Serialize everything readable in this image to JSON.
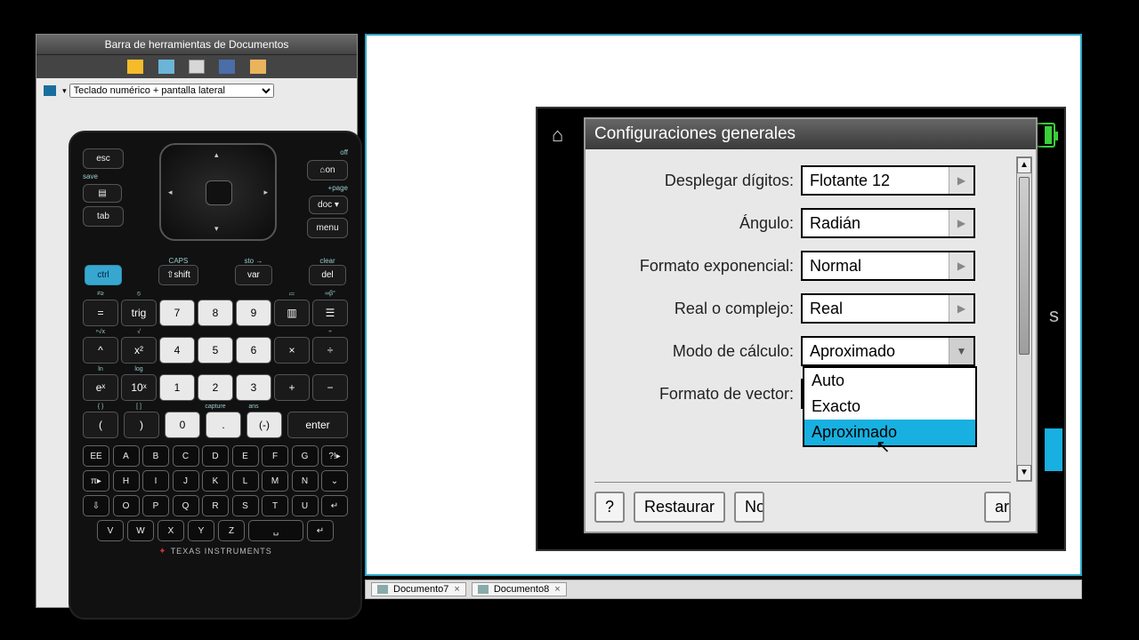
{
  "toolbar": {
    "title": "Barra de herramientas de Documentos"
  },
  "view_selector": {
    "value": "Teclado numérico + pantalla lateral"
  },
  "calc": {
    "esc": "esc",
    "on": "⌂on",
    "off": "off",
    "save": "save",
    "page": "+page",
    "doc": "doc ▾",
    "tab": "tab",
    "menu": "menu",
    "caps": "CAPS",
    "shift": "⇧shift",
    "sto": "sto →",
    "var": "var",
    "clear": "clear",
    "del": "del",
    "ctrl": "ctrl",
    "eq": "=",
    "trig": "trig",
    "enter": "enter",
    "capture": "capture",
    "ans": "ans",
    "brand": "TEXAS INSTRUMENTS",
    "nums": {
      "7": "7",
      "8": "8",
      "9": "9",
      "4": "4",
      "5": "5",
      "6": "6",
      "1": "1",
      "2": "2",
      "3": "3",
      "0": "0",
      "dot": ".",
      "neg": "(-)"
    },
    "ops": {
      "mul": "×",
      "div": "÷",
      "plus": "+",
      "minus": "−"
    },
    "fx": {
      "caret": "^",
      "x2": "x²",
      "ex": "eˣ",
      "tenx": "10ˣ",
      "lp": "(",
      "rp": ")"
    },
    "alpha": [
      "EE",
      "A",
      "B",
      "C",
      "D",
      "E",
      "F",
      "G",
      "?!▸",
      "π▸",
      "H",
      "I",
      "J",
      "K",
      "L",
      "M",
      "N",
      "⌄",
      "⇩",
      "O",
      "P",
      "Q",
      "R",
      "S",
      "T",
      "U",
      "↵",
      "V",
      "W",
      "X",
      "Y",
      "Z",
      "␣",
      "↵"
    ]
  },
  "dialog": {
    "title": "Configuraciones generales",
    "rows": [
      {
        "label": "Desplegar dígitos:",
        "value": "Flotante 12"
      },
      {
        "label": "Ángulo:",
        "value": "Radián"
      },
      {
        "label": "Formato exponencial:",
        "value": "Normal"
      },
      {
        "label": "Real o complejo:",
        "value": "Real"
      },
      {
        "label": "Modo de cálculo:",
        "value": "Aproximado",
        "open": true
      },
      {
        "label": "Formato de vector:",
        "value": ""
      }
    ],
    "options": [
      "Auto",
      "Exacto",
      "Aproximado"
    ],
    "buttons": {
      "help": "?",
      "restore": "Restaurar",
      "no": "No",
      "apply_cut": "ar"
    }
  },
  "bg_text": {
    "s": "s"
  },
  "tabs": [
    {
      "label": "Documento7"
    },
    {
      "label": "Documento8"
    }
  ]
}
